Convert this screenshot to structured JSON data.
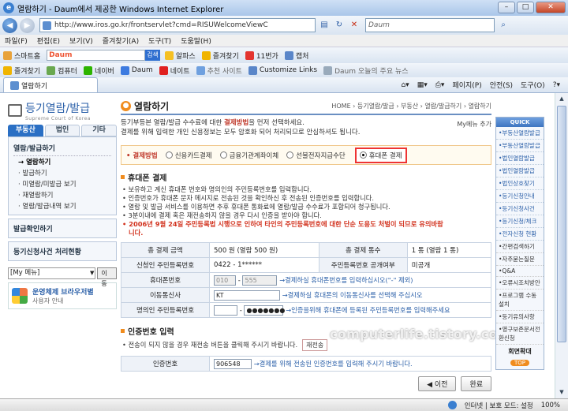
{
  "window": {
    "title": "열람하기 - Daum에서 제공한 Windows Internet Explorer"
  },
  "address": {
    "url": "http://www.iros.go.kr/frontservlet?cmd=RISUWelcomeViewC",
    "search_placeholder": "Daum"
  },
  "menu": [
    "파일(F)",
    "편집(E)",
    "보기(V)",
    "즐겨찾기(A)",
    "도구(T)",
    "도움말(H)"
  ],
  "toolbar1": {
    "home": "스마트홈",
    "daum_logo": "Daum",
    "search_btn": "검색",
    "items": [
      "알파스",
      "즐겨찾기",
      "11번가",
      "캡처"
    ]
  },
  "toolbar2": {
    "fav": "즐겨찾기",
    "items": [
      "컴퓨터",
      "네이버",
      "Daum",
      "네이트",
      "추천 사이트",
      "Customize Links",
      "Daum 오늘의 주요 뉴스"
    ]
  },
  "tab": {
    "label": "열람하기",
    "cmds": [
      "페이지(P)",
      "안전(S)",
      "도구(O)"
    ]
  },
  "sidebar": {
    "logo_main": "등기열람/발급",
    "logo_sub": "Supreme Court of Korea",
    "tabs": [
      "부동산",
      "법인",
      "기타"
    ],
    "section1": "열람/발급하기",
    "items": [
      "→ 열람하기",
      "· 발급하기",
      "· 미열람/미발급 보기",
      "· 재열람하기",
      "· 열람/발급내역 보기"
    ],
    "section2": "발급확인하기",
    "section3": "등기신청사건 처리현황",
    "mymenu": "[My 메뉴]",
    "go": "이동",
    "os_title": "운영체제 브라우저별",
    "os_sub": "사용자 안내"
  },
  "content": {
    "title": "열람하기",
    "breadcrumb": "HOME › 등기열람/발급 › 부동산 › 열람/발급하기 › 열람하기",
    "intro1a": "등기부등본 열람/발급 수수료에 대한 ",
    "intro1b": "결제방법",
    "intro1c": "을 먼저 선택하세요.",
    "intro2": "결제를 위해 입력한 개인 신용정보는 모두 암호화 되어 처리되므로 안심하셔도 됩니다.",
    "myhelp": "My메뉴 추가",
    "pay_label": "• 결제방법",
    "pay_options": [
      "신용카드결제",
      "금융기관계좌이체",
      "선불전자지급수단",
      "휴대폰 결제"
    ],
    "sec1": "휴대폰 결제",
    "notes": [
      "• 보유하고 계신 휴대폰 번호와 명의인의 주민등록번호를 입력합니다.",
      "• 인증번호가 휴대폰 문자 메시지로 전송된 것을 확인하신 후 전송된 인증번호를 입력합니다.",
      "• 열람 및 발급 서비스를 이용하면 추후 휴대폰 통화료에 열람/발급 수수료가 포함되어 청구됩니다.",
      "• 3분이내에 결제 혹은 재전송하지 않을 경우 다시 인증을 받아야 합니다."
    ],
    "warn1": "• 2006년 9월 24일 주민등록법 시행으로 인하여 타인의 주민등록번호에 대한 단순 도용도 처벌이 되므로 유의바람",
    "warn2": "니다.",
    "t_amount_h": "총 결제 금액",
    "t_amount": "500 원 (열람 500 원)",
    "t_count_h": "총 결제 통수",
    "t_count": "1 통 (열람 1 통)",
    "t_applicant_h": "신청인 주민등록번호",
    "t_applicant": "0422 - 1******",
    "t_public_h": "주민등록번호 공개여부",
    "t_public": "미공개",
    "t_phone_h": "휴대폰번호",
    "t_phone1": "010",
    "t_phone2": "555",
    "t_phone_hint": "→결제하실 휴대폰번호를 입력하십시오(\"-\" 제외)",
    "t_carrier_h": "이동통신사",
    "t_carrier": "KT",
    "t_carrier_hint": "→결제하실 휴대폰의 이동통신사를 선택해 주십시오",
    "t_owner_h": "명의인 주민등록번호",
    "t_owner2": "●●●●●●●",
    "t_owner_hint": "→인증을위해 휴대폰에 등록된 주민등록번호를 입력해주세요",
    "sec2": "인증번호 입력",
    "resend_note": "• 전송이 되지 않을 경우 재전송 버튼을 클릭해 주시기 바랍니다.",
    "resend_btn": "재전송",
    "t_code_h": "인증번호",
    "t_code": "906548",
    "t_code_hint": "→결제를 위해 전송된 인증번호를 입력해 주시기 바랍니다.",
    "prev": "◀ 이전",
    "done": "완료",
    "watermark": "computerlife.tistory.com"
  },
  "quick": {
    "head": "QUICK",
    "items": [
      "•부동산열람발급",
      "•부동산열람발급",
      "•법인열람발급",
      "•법인열람발급",
      "•법인상호찾기",
      "•등기신청안내",
      "•등기신청사건",
      "•등기신청/체크",
      "•전자신청 현황"
    ],
    "items2": [
      "•간편검색하기",
      "•자주묻는질문",
      "•Q&A",
      "•오류시조치방안",
      "•프로그램 수동설치",
      "•등기유의사항",
      "•영구보존문서전환신청"
    ],
    "footer": "회면확대",
    "top": "TOP"
  },
  "status": {
    "zone": "인터넷 | 보호 모드: 설정",
    "zoom": "100%"
  }
}
